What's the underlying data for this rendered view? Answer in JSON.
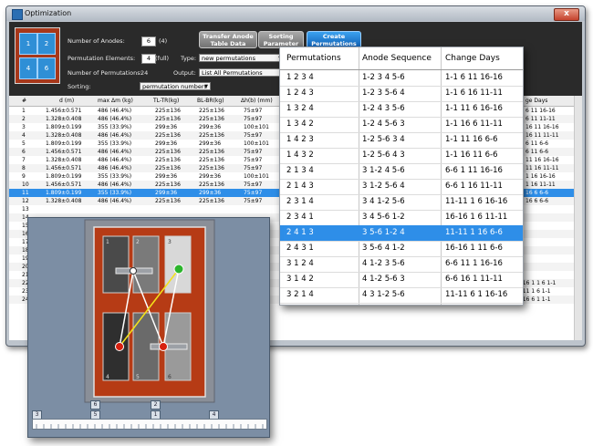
{
  "window": {
    "title": "Optimization",
    "close_label": "x"
  },
  "thumbnail": {
    "cells": [
      "1",
      "2",
      "3",
      "4",
      "5",
      "6"
    ]
  },
  "settings": {
    "anodes_label": "Number of Anodes:",
    "anodes_value": "6",
    "anodes_paren": "(4)",
    "elements_label": "Permutation Elements:",
    "elements_value": "4",
    "elements_paren": "(full)",
    "count_label": "Number of Permutations:",
    "count_value": "24",
    "sorting_label": "Sorting:",
    "sorting_value": "permutation numbers",
    "type_label": "Type:",
    "type_value": "new permutations",
    "output_label": "Output:",
    "output_value": "List All Permutations"
  },
  "buttons": {
    "transfer_line1": "Transfer Anode",
    "transfer_line2": "Table Data",
    "sorting_line1": "Sorting",
    "sorting_line2": "Parameter",
    "create_line1": "Create",
    "create_line2": "Permutations"
  },
  "bg_table": {
    "headers": [
      "#",
      "d (m)",
      "max Δm (kg)",
      "TL-TR(kg)",
      "BL-BR(kg)",
      "Δh(b) (mm)"
    ],
    "rows": [
      [
        "1",
        "1.456±0.571",
        "486 (46.4%)",
        "225±136",
        "225±136",
        "75±97"
      ],
      [
        "2",
        "1.328±0.408",
        "486 (46.4%)",
        "225±136",
        "225±136",
        "75±97"
      ],
      [
        "3",
        "1.809±0.199",
        "355 (33.9%)",
        "299±36",
        "299±36",
        "100±101"
      ],
      [
        "4",
        "1.328±0.408",
        "486 (46.4%)",
        "225±136",
        "225±136",
        "75±97"
      ],
      [
        "5",
        "1.809±0.199",
        "355 (33.9%)",
        "299±36",
        "299±36",
        "100±101"
      ],
      [
        "6",
        "1.456±0.571",
        "486 (46.4%)",
        "225±136",
        "225±136",
        "75±97"
      ],
      [
        "7",
        "1.328±0.408",
        "486 (46.4%)",
        "225±136",
        "225±136",
        "75±97"
      ],
      [
        "8",
        "1.456±0.571",
        "486 (46.4%)",
        "225±136",
        "225±136",
        "75±97"
      ],
      [
        "9",
        "1.809±0.199",
        "355 (33.9%)",
        "299±36",
        "299±36",
        "100±101"
      ],
      [
        "10",
        "1.456±0.571",
        "486 (46.4%)",
        "225±136",
        "225±136",
        "75±97"
      ],
      [
        "11",
        "1.809±0.199",
        "355 (33.9%)",
        "299±36",
        "299±36",
        "75±97"
      ],
      [
        "12",
        "1.328±0.408",
        "486 (46.4%)",
        "225±136",
        "225±136",
        "75±97"
      ]
    ],
    "selected_index": 10,
    "row_numbers_lower": [
      "13",
      "14",
      "15",
      "16",
      "17",
      "18",
      "19",
      "20",
      "21",
      "22",
      "23",
      "24"
    ],
    "partial_rows": [
      [
        "150±87",
        "894±901",
        "1341±783",
        "4 2 3 1",
        "5-6 3 4 1-2",
        "16-16 1 1 6 1-1"
      ],
      [
        "167±75",
        "671±872",
        "1490±674",
        "4 3 1 2",
        "5-6 4 3 1-2",
        "11-11 1 6 1-1"
      ],
      [
        "183±56",
        "671±872",
        "1640±502",
        "4 3 2 1",
        "5-6 4 3 1-2",
        "16-16 6 1 1-1"
      ]
    ],
    "right_header": "ge Days",
    "right_col": [
      "6 11 16-16",
      "6 11 11-11",
      "16 11 16-16",
      "16 11 11-11",
      "6 11 6-6",
      "6 11 6-6",
      "11 16 16-16",
      "11 16 11-11",
      "1 16 16-16",
      "1 16 11-11",
      "16 6 6-6",
      "16 6 6-6"
    ]
  },
  "popup": {
    "headers": [
      "Permutations",
      "Anode Sequence",
      "Change Days"
    ],
    "rows": [
      [
        "1 2 3 4",
        "1-2 3 4 5-6",
        "1-1 6 11 16-16"
      ],
      [
        "1 2 4 3",
        "1-2 3 5-6 4",
        "1-1 6 16 11-11"
      ],
      [
        "1 3 2 4",
        "1-2 4 3 5-6",
        "1-1 11 6 16-16"
      ],
      [
        "1 3 4 2",
        "1-2 4 5-6 3",
        "1-1 16 6 11-11"
      ],
      [
        "1 4 2 3",
        "1-2 5-6 3 4",
        "1-1 11 16 6-6"
      ],
      [
        "1 4 3 2",
        "1-2 5-6 4 3",
        "1-1 16 11 6-6"
      ],
      [
        "2 1 3 4",
        "3 1-2 4 5-6",
        "6-6 1 11 16-16"
      ],
      [
        "2 1 4 3",
        "3 1-2 5-6 4",
        "6-6 1 16 11-11"
      ],
      [
        "2 3 1 4",
        "3 4 1-2 5-6",
        "11-11 1 6 16-16"
      ],
      [
        "2 3 4 1",
        "3 4 5-6 1-2",
        "16-16 1 6 11-11"
      ],
      [
        "2 4 1 3",
        "3 5-6 1-2 4",
        "11-11 1 16 6-6"
      ],
      [
        "2 4 3 1",
        "3 5-6 4 1-2",
        "16-16 1 11 6-6"
      ],
      [
        "3 1 2 4",
        "4 1-2 3 5-6",
        "6-6 11 1 16-16"
      ],
      [
        "3 1 4 2",
        "4 1-2 5-6 3",
        "6-6 16 1 11-11"
      ],
      [
        "3 2 1 4",
        "4 3 1-2 5-6",
        "11-11 6 1 16-16"
      ]
    ],
    "selected_index": 10
  },
  "zoom": {
    "slot_numbers": [
      "1",
      "2",
      "3",
      "4",
      "5",
      "6"
    ],
    "bottom_tags_upper": [
      "6",
      "2"
    ],
    "bottom_tags_lower": [
      "3",
      "5",
      "1",
      "4"
    ],
    "colors": {
      "red": "#b53a14",
      "green": "#2db52d",
      "yellow": "#f4e21a",
      "white": "#ffffff"
    }
  }
}
